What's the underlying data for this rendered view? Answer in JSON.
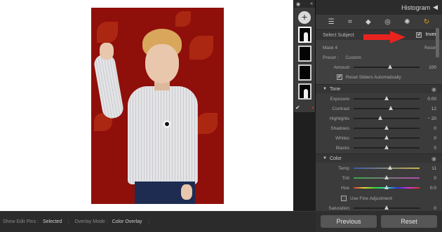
{
  "panel": {
    "title": "Histogram",
    "collapse_arrow": "◀",
    "tools": [
      "sliders-icon",
      "crop-icon",
      "eraser-icon",
      "redeye-icon",
      "mask-icon",
      "history-icon"
    ],
    "subject_row": {
      "label": "Select Subject",
      "invert_label": "Invert",
      "invert_checked": true
    }
  },
  "mask": {
    "name": "Mask 4",
    "reset_label": "Reset",
    "preset_label": "Preset :",
    "preset_value": "Custom",
    "amount_label": "Amount",
    "amount_value": "100",
    "amount_level": 0.55,
    "reset_sliders_label": "Reset Sliders Automatically"
  },
  "tone": {
    "title": "Tone",
    "rows": [
      {
        "label": "Exposure",
        "value": "0.00",
        "level": 0.5
      },
      {
        "label": "Contrast",
        "value": "12",
        "level": 0.56
      },
      {
        "label": "Highlights",
        "value": "− 20",
        "level": 0.4
      },
      {
        "label": "Shadows",
        "value": "0",
        "level": 0.5
      },
      {
        "label": "Whites",
        "value": "0",
        "level": 0.5
      },
      {
        "label": "Blacks",
        "value": "0",
        "level": 0.5
      }
    ]
  },
  "color": {
    "title": "Color",
    "rows": [
      {
        "label": "Temp",
        "value": "11",
        "level": 0.55
      },
      {
        "label": "Tint",
        "value": "0",
        "level": 0.5
      },
      {
        "label": "Hue",
        "value": "0.0",
        "level": 0.5
      }
    ],
    "fine_label": "Use Fine Adjustment",
    "saturation_label": "Saturation",
    "saturation_value": "0",
    "saturation_level": 0.5
  },
  "nav": {
    "previous": "Previous",
    "reset": "Reset"
  },
  "bottombar": {
    "show_edit_pins_label": "Show Edit Pins :",
    "show_edit_pins_value": "Selected",
    "overlay_mode_label": "Overlay Mode :",
    "overlay_mode_value": "Color Overlay"
  },
  "colors": {
    "accent": "#e3a21a",
    "overlay": "#8f0f0a",
    "arrow": "#e8231e"
  }
}
